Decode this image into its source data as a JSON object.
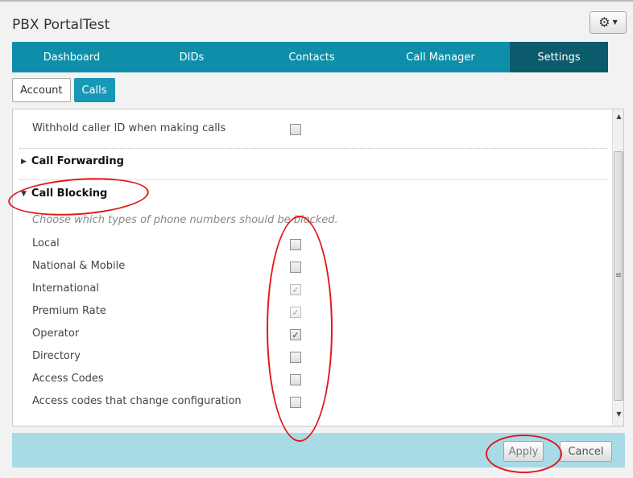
{
  "app": {
    "title": "PBX PortalTest"
  },
  "header": {
    "settings_icon": "gear-icon",
    "menu_caret": "chevron-down-icon"
  },
  "nav": {
    "tabs": [
      {
        "label": "Dashboard",
        "active": false
      },
      {
        "label": "DIDs",
        "active": false
      },
      {
        "label": "Contacts",
        "active": false
      },
      {
        "label": "Call Manager",
        "active": false
      },
      {
        "label": "Settings",
        "active": true
      }
    ]
  },
  "subtabs": [
    {
      "label": "Account",
      "active": false
    },
    {
      "label": "Calls",
      "active": true
    }
  ],
  "settings": {
    "withhold_label": "Withhold caller ID when making calls",
    "withhold_checked": false,
    "call_forwarding": {
      "title": "Call Forwarding",
      "expanded": false
    },
    "call_blocking": {
      "title": "Call Blocking",
      "expanded": true,
      "hint": "Choose which types of phone numbers should be blocked.",
      "items": [
        {
          "label": "Local",
          "checked": false,
          "disabled": false
        },
        {
          "label": "National & Mobile",
          "checked": false,
          "disabled": false
        },
        {
          "label": "International",
          "checked": true,
          "disabled": true
        },
        {
          "label": "Premium Rate",
          "checked": true,
          "disabled": true
        },
        {
          "label": "Operator",
          "checked": true,
          "disabled": false
        },
        {
          "label": "Directory",
          "checked": false,
          "disabled": false
        },
        {
          "label": "Access Codes",
          "checked": false,
          "disabled": false
        },
        {
          "label": "Access codes that change configuration",
          "checked": false,
          "disabled": false
        }
      ]
    }
  },
  "footer": {
    "apply_label": "Apply",
    "cancel_label": "Cancel",
    "apply_enabled": false
  },
  "colors": {
    "nav": "#0e8fa9",
    "nav_active": "#0c5b6c",
    "accent": "#1698b6",
    "footer": "#a9dbe7",
    "annotation": "#e01a1a"
  }
}
